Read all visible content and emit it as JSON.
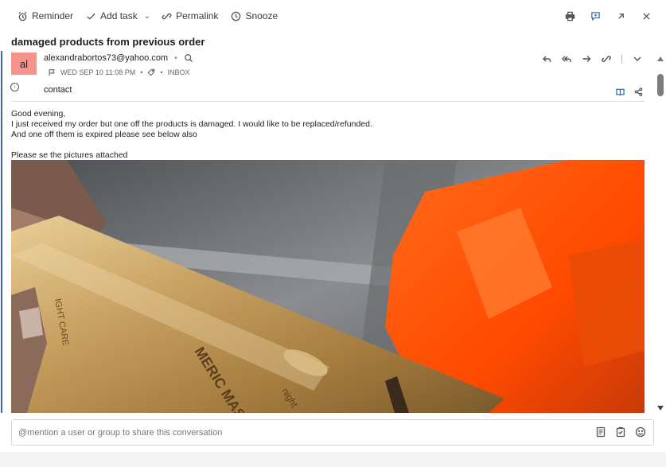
{
  "toolbar": {
    "reminder_label": "Reminder",
    "add_task_label": "Add task",
    "permalink_label": "Permalink",
    "snooze_label": "Snooze"
  },
  "conversation": {
    "subject": "damaged products from previous order"
  },
  "message": {
    "avatar_initials": "al",
    "avatar_color": "#f4948a",
    "from_email": "alexandrabortos73@yahoo.com",
    "date": "WED SEP 10 11:08 PM",
    "folder": "INBOX",
    "to": "contact",
    "body_lines": [
      "Good evening,",
      "I just received my order but one off the products is damaged. I would like to be replaced/refunded.",
      "And one off them is expired please see below also",
      "",
      "Please se the pictures attached"
    ]
  },
  "photo": {
    "tube_text_left": "IGHT CARE",
    "tube_text_main": "MERIC MASK",
    "tube_text_night": "night"
  },
  "compose": {
    "placeholder": "@mention a user or group to share this conversation"
  },
  "colors": {
    "accent_bar": "#3a62b6",
    "link_blue": "#3a6fb0"
  }
}
